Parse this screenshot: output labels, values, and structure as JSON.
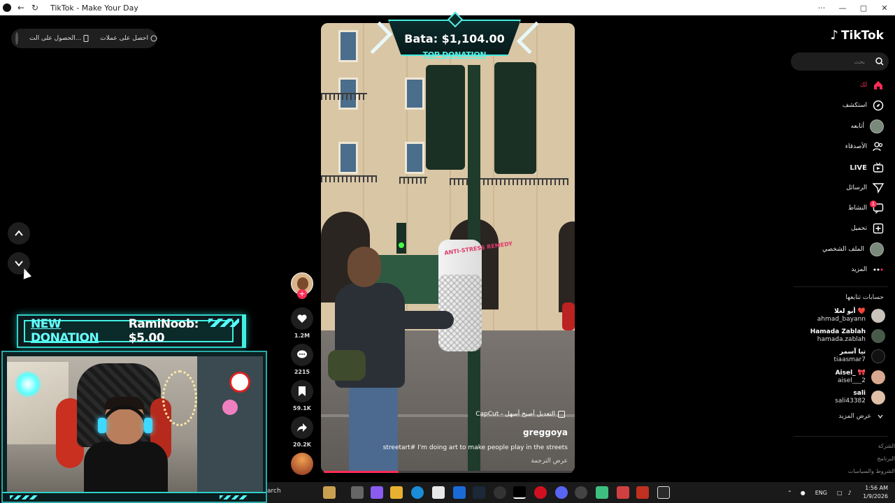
{
  "browser": {
    "title": "TikTok - Make Your Day",
    "menu_label": "···",
    "min_label": "—",
    "max_label": "▢",
    "close_label": "✕"
  },
  "topleft": {
    "coins_label": "احصل على عملات",
    "app_label": "الحصول على الت..."
  },
  "donation_banner": {
    "new_label": "NEW DONATION",
    "donor_amount": "RamiNoob: $5.00"
  },
  "top_donation": {
    "amount": "Bata: $1,104.00",
    "label": "TOP DONATION"
  },
  "video": {
    "capcut_label": "CapCut - التعديل أصبح أسهل",
    "author": "greggoya",
    "description": "streetart# I'm doing art to make people play in the streets",
    "translate_label": "عرض الترجمة",
    "roll_text": "ANTI-STRESS REMEDY",
    "progress": 0.3
  },
  "actions": {
    "likes": "1.2M",
    "comments": "2215",
    "saves": "59.1K",
    "shares": "20.2K",
    "follow_label": "+"
  },
  "sidebar": {
    "logo": "TikTok",
    "search_placeholder": "بحث",
    "items": [
      {
        "label": "لك",
        "icon": "home-icon",
        "active": true
      },
      {
        "label": "استكشف",
        "icon": "compass-icon"
      },
      {
        "label": "أتابعه",
        "icon": "following-avatar"
      },
      {
        "label": "الأصدقاء",
        "icon": "friends-icon"
      },
      {
        "label": "LIVE",
        "icon": "live-icon"
      },
      {
        "label": "الرسائل",
        "icon": "messages-icon"
      },
      {
        "label": "النشاط",
        "icon": "activity-icon",
        "badge": "1"
      },
      {
        "label": "تحميل",
        "icon": "upload-icon"
      },
      {
        "label": "الملف الشخصي",
        "icon": "profile-avatar"
      },
      {
        "label": "المزيد",
        "icon": "more-icon"
      }
    ],
    "following_title": "حسابات تتابعها",
    "accounts": [
      {
        "name": "أبو لعلا ❤️",
        "username": "ahmad_bayann"
      },
      {
        "name": "Hamada Zablah",
        "username": "hamada.zablah"
      },
      {
        "name": "تيا آسمر",
        "username": "tiaasmar7"
      },
      {
        "name": "Aisel_ 🎀",
        "username": "aisel___2"
      },
      {
        "name": "sali",
        "username": "sali43382"
      }
    ],
    "see_more": "عرض المزيد",
    "footer": [
      "الشركة",
      "البرنامج",
      "الشروط والسياسات"
    ]
  },
  "taskbar": {
    "search_text": "arch",
    "lang": "ENG",
    "time": "1:56 AM",
    "date": "1/9/2026"
  },
  "colors": {
    "accent": "#fe2c55",
    "overlay_cyan": "#43e8dc",
    "background": "#000000"
  }
}
